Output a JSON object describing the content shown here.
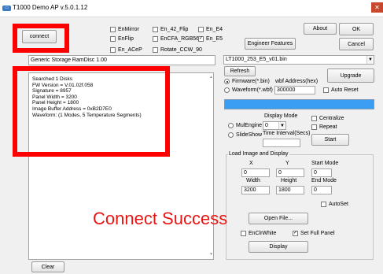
{
  "window": {
    "title": "T1000 Demo AP v.5.0.1.12",
    "app_icon": "app-icon",
    "close_icon": "close-icon"
  },
  "toolbar": {
    "connect": "connect",
    "about": "About",
    "ok": "OK",
    "cancel": "Cancel",
    "engineer_features": "Engineer Features",
    "checkboxes": {
      "enmirror": "EnMirror",
      "en42flip": "En_42_Flip",
      "ene4": "En_E4",
      "enflip": "EnFlip",
      "encfa": "EnCFA_RGB565",
      "ene5": "En_E5",
      "enacep": "En_ACeP",
      "rotate": "Rotate_CCW_90"
    },
    "checked": {
      "ene5": true
    }
  },
  "left": {
    "storage": "Generic Storage RamDisc 1.00",
    "log": [
      "Searched 1 Disks",
      "FW Version = V.01.02f.058",
      "Signature = 8957",
      "Panel Width = 3200",
      "Panel Height = 1800",
      "Image Buffer Address = 0xB2D7E0",
      "Waveform: (1 Modes, 5 Temperature Segments)"
    ],
    "clear": "Clear"
  },
  "right": {
    "file_combo": "LT1000_253_E5_v01.bin",
    "refresh": "Refresh",
    "upgrade": "Upgrade",
    "firmware_radio": "Firmware(*.bin)",
    "waveform_radio": "Waveform(*.wbf)",
    "wbf_address_label": "wbf Address(hex)",
    "wbf_address_value": "300000",
    "auto_reset": "Auto Reset",
    "display_mode_label": "Display Mode",
    "display_mode_value": "0",
    "mulengine": "MulEngine",
    "slideshow": "SlideShow",
    "time_interval_label": "Time Interval(Secs)",
    "time_interval_value": "",
    "centralize": "Centralize",
    "repeat": "Repeat",
    "start": "Start",
    "group_title": "Load Image and Display",
    "x_label": "X",
    "y_label": "Y",
    "start_mode_label": "Start Mode",
    "x_value": "0",
    "y_value": "0",
    "start_mode_value": "0",
    "width_label": "Width",
    "height_label": "Height",
    "end_mode_label": "End Mode",
    "width_value": "3200",
    "height_value": "1800",
    "end_mode_value": "0",
    "autoset": "AutoSet",
    "open_file": "Open File...",
    "enclrwhite": "EnClrWhite",
    "set_full_panel": "Set Full Panel",
    "display": "Display",
    "checked": {
      "set_full_panel": true
    }
  },
  "annotation": {
    "text": "Connect Success",
    "color": "#e81515"
  }
}
